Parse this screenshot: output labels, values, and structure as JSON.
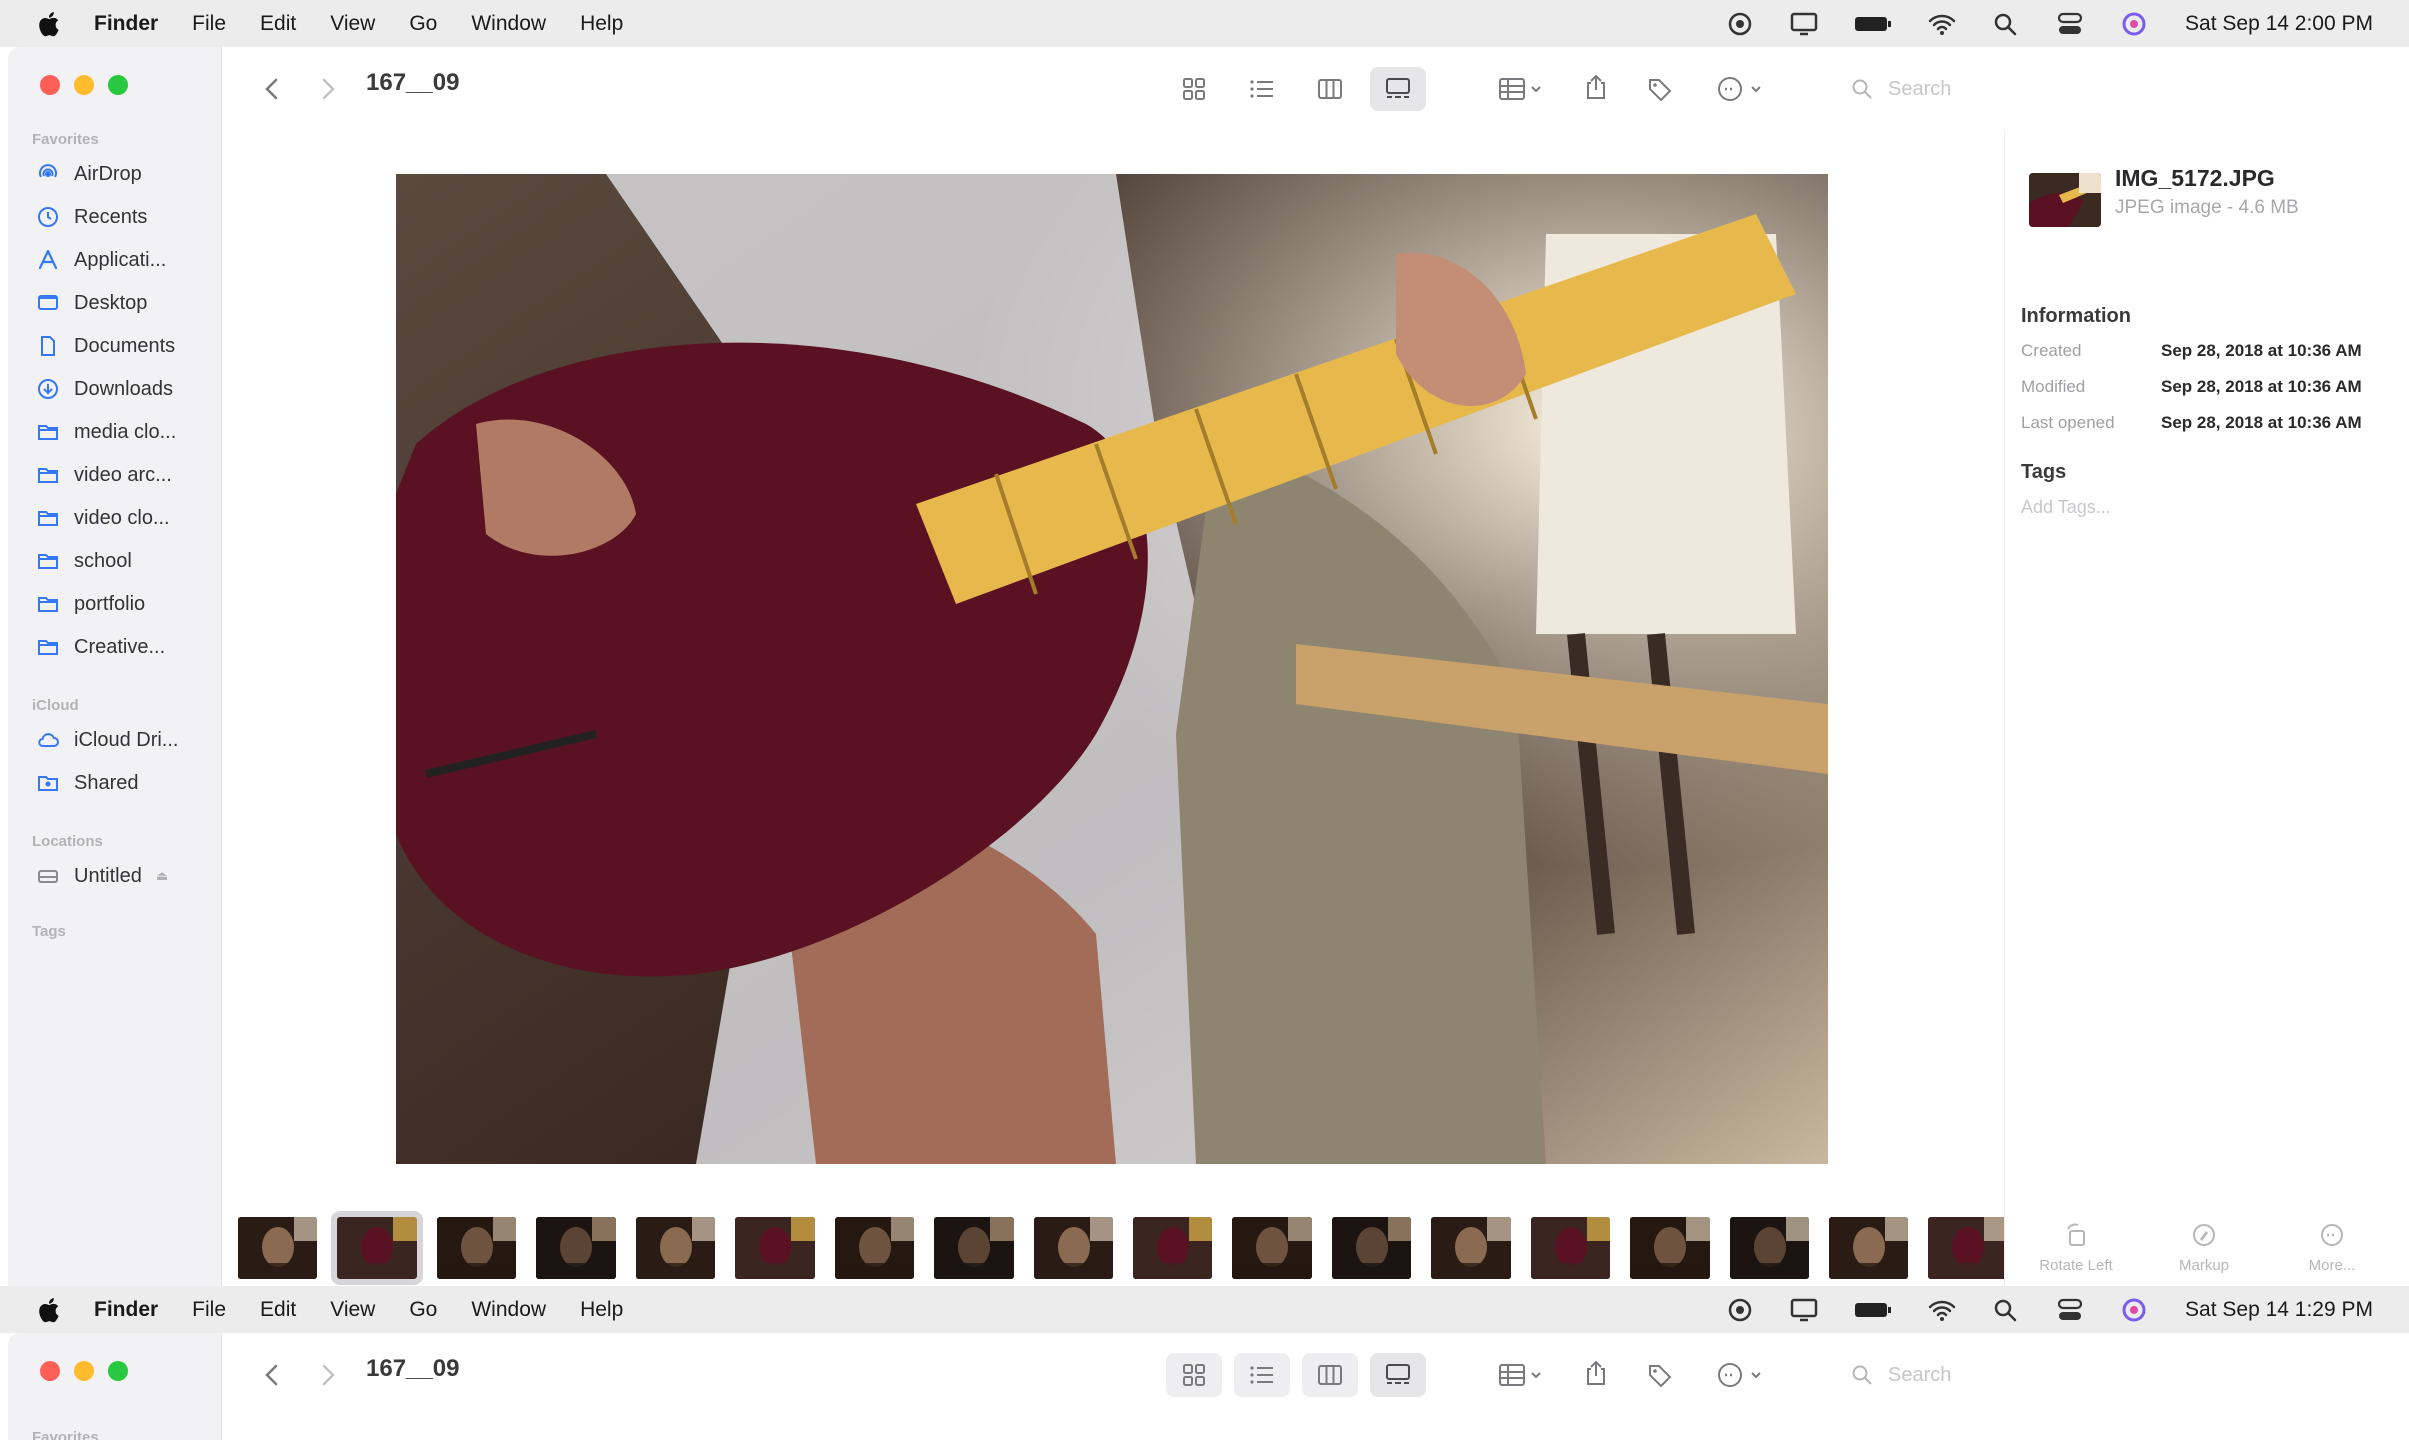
{
  "menubar": {
    "app_name": "Finder",
    "menus": [
      "File",
      "Edit",
      "View",
      "Go",
      "Window",
      "Help"
    ],
    "status_icons": [
      "screen-sharing-icon",
      "display-icon",
      "battery-icon",
      "wifi-icon",
      "search-icon",
      "control-center-icon",
      "siri-icon"
    ]
  },
  "screenA": {
    "clock": "Sat Sep 14  2:00 PM"
  },
  "screenB": {
    "clock": "Sat Sep 14  1:29 PM"
  },
  "toolbar": {
    "folder_title": "167__09",
    "search_placeholder": "Search"
  },
  "sidebar": {
    "favorites_label": "Favorites",
    "favorites": [
      {
        "label": "AirDrop",
        "icon": "airdrop-icon"
      },
      {
        "label": "Recents",
        "icon": "clock-icon"
      },
      {
        "label": "Applicati...",
        "icon": "applications-icon"
      },
      {
        "label": "Desktop",
        "icon": "desktop-icon"
      },
      {
        "label": "Documents",
        "icon": "document-icon"
      },
      {
        "label": "Downloads",
        "icon": "download-icon"
      },
      {
        "label": "media clo...",
        "icon": "folder-icon"
      },
      {
        "label": "video arc...",
        "icon": "folder-icon"
      },
      {
        "label": "video clo...",
        "icon": "folder-icon"
      },
      {
        "label": "school",
        "icon": "folder-icon"
      },
      {
        "label": "portfolio",
        "icon": "folder-icon"
      },
      {
        "label": "Creative...",
        "icon": "folder-icon"
      }
    ],
    "icloud_label": "iCloud",
    "icloud": [
      {
        "label": "iCloud Dri...",
        "icon": "cloud-icon"
      },
      {
        "label": "Shared",
        "icon": "shared-folder-icon"
      }
    ],
    "locations_label": "Locations",
    "locations": [
      {
        "label": "Untitled",
        "icon": "disk-icon"
      }
    ],
    "tags_label": "Tags"
  },
  "inspector": {
    "file_name": "IMG_5172.JPG",
    "file_kind": "JPEG image - 4.6 MB",
    "information_label": "Information",
    "rows": [
      {
        "key": "Created",
        "value": "Sep 28, 2018 at 10:36 AM"
      },
      {
        "key": "Modified",
        "value": "Sep 28, 2018 at 10:36 AM"
      },
      {
        "key": "Last opened",
        "value": "Sep 28, 2018 at 10:36 AM"
      }
    ],
    "tags_label": "Tags",
    "add_tags_placeholder": "Add Tags...",
    "actions": [
      {
        "label": "Rotate Left",
        "icon": "rotate-left-icon"
      },
      {
        "label": "Markup",
        "icon": "markup-icon"
      },
      {
        "label": "More...",
        "icon": "more-icon"
      }
    ]
  },
  "filmstrip": {
    "count": 18,
    "selected_index": 1
  },
  "colors": {
    "accent": "#3478f6",
    "traffic_red": "#ff5f57",
    "traffic_yellow": "#febc2e",
    "traffic_green": "#28c840"
  }
}
